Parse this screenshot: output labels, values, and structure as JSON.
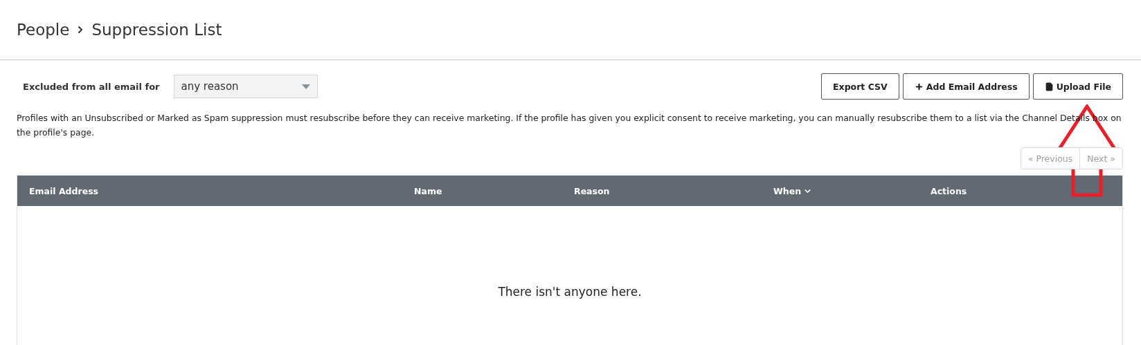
{
  "breadcrumb": [
    {
      "label": "People"
    },
    {
      "label": "Suppression List"
    }
  ],
  "filter": {
    "label": "Excluded from all email for",
    "value": "any reason"
  },
  "buttons": [
    {
      "kind": "plain",
      "label": "Export CSV"
    },
    {
      "kind": "add",
      "label": "Add Email Address"
    },
    {
      "kind": "file",
      "label": "Upload File"
    }
  ],
  "notice": "Profiles with an Unsubscribed or Marked as Spam suppression must resubscribe before they can receive marketing. If the profile has given you explicit consent to receive marketing, you can manually resubscribe them to a list via the Channel Details box on the profile's page.",
  "pagination": [
    {
      "label": "« Previous",
      "disabled": true
    },
    {
      "label": "Next »",
      "disabled": true
    }
  ],
  "table": {
    "columns": [
      {
        "label": "Email Address",
        "sorted": false
      },
      {
        "label": "Name",
        "sorted": false
      },
      {
        "label": "Reason",
        "sorted": false
      },
      {
        "label": "When",
        "sorted": true
      },
      {
        "label": "Actions",
        "sorted": false
      }
    ],
    "empty_message": "There isn't anyone here."
  }
}
